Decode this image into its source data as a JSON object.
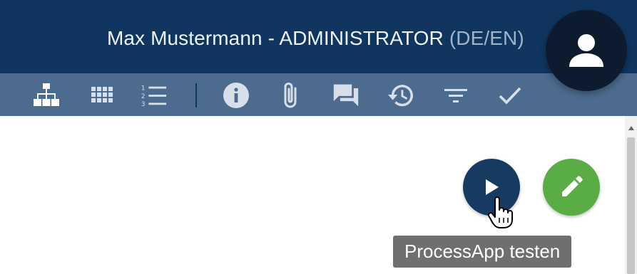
{
  "header": {
    "user_title": "Max Mustermann - ADMINISTRATOR",
    "language": "(DE/EN)"
  },
  "colors": {
    "header_bg": "#10365f",
    "toolbar_bg": "#4c6b8e",
    "play_button": "#173a61",
    "edit_button": "#5aad45",
    "tooltip_bg": "#6f6f6f"
  },
  "toolbar": {
    "icons": [
      "sitemap-icon",
      "grid-icon",
      "numbered-list-icon",
      "info-icon",
      "attachment-icon",
      "comments-icon",
      "history-icon",
      "filter-icon",
      "check-icon"
    ]
  },
  "avatar": {
    "icon": "person-icon"
  },
  "actions": {
    "play_icon": "play-icon",
    "edit_icon": "pencil-icon",
    "tooltip": "ProcessApp testen"
  }
}
